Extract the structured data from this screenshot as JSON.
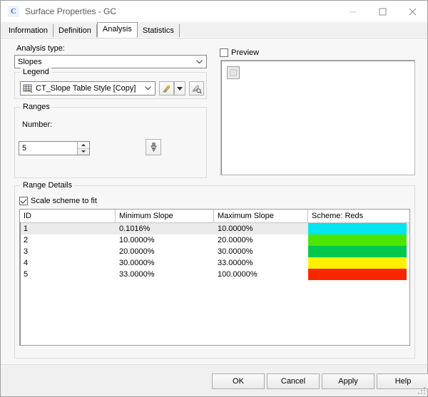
{
  "window": {
    "title": "Surface Properties - GC",
    "icon": "civil3d-c-icon",
    "minimize_label": "minimize-icon",
    "maximize_label": "maximize-icon",
    "close_label": "close-icon"
  },
  "tabs": [
    {
      "label": "Information",
      "active": false
    },
    {
      "label": "Definition",
      "active": false
    },
    {
      "label": "Analysis",
      "active": true
    },
    {
      "label": "Statistics",
      "active": false
    }
  ],
  "analysis": {
    "type_label": "Analysis type:",
    "type_value": "Slopes"
  },
  "legend": {
    "group_title": "Legend",
    "style_value": "CT_Slope Table Style [Copy]",
    "table_icon": "table-style-icon",
    "edit_icon": "edit-style-icon",
    "dropdown_icon": "chevron-down-icon",
    "preview_icon": "preview-style-icon"
  },
  "ranges": {
    "group_title": "Ranges",
    "number_label": "Number:",
    "number_value": "5",
    "run_icon": "run-analysis-icon"
  },
  "preview": {
    "checkbox_label": "Preview",
    "checked": false,
    "placeholder_icon": "preview-placeholder-icon"
  },
  "range_details": {
    "group_title": "Range Details",
    "scale_label": "Scale scheme to fit",
    "scale_checked": true,
    "columns": [
      "ID",
      "Minimum Slope",
      "Maximum Slope",
      "Scheme: Reds"
    ],
    "rows": [
      {
        "id": "1",
        "min": "0.1016%",
        "max": "10.0000%",
        "color": "#00e5ef",
        "selected": true
      },
      {
        "id": "2",
        "min": "10.0000%",
        "max": "20.0000%",
        "color": "#4ce600",
        "selected": false
      },
      {
        "id": "3",
        "min": "20.0000%",
        "max": "30.0000%",
        "color": "#00c84c",
        "selected": false
      },
      {
        "id": "4",
        "min": "30.0000%",
        "max": "33.0000%",
        "color": "#fff000",
        "selected": false
      },
      {
        "id": "5",
        "min": "33.0000%",
        "max": "100.0000%",
        "color": "#fa2600",
        "selected": false
      }
    ]
  },
  "footer": {
    "ok": "OK",
    "cancel": "Cancel",
    "apply": "Apply",
    "help": "Help"
  }
}
